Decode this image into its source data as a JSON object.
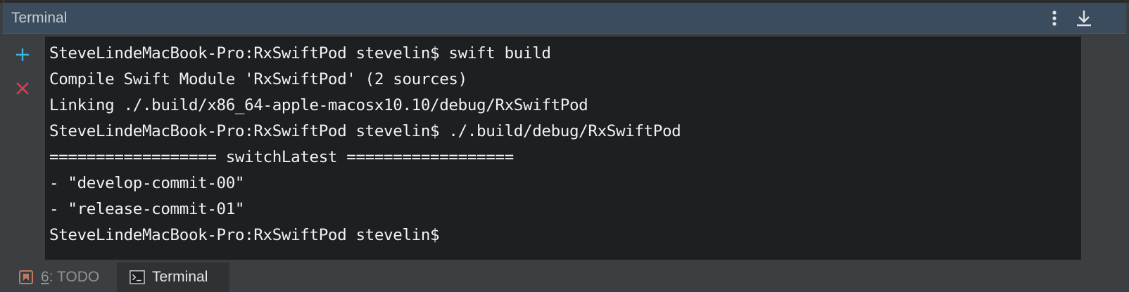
{
  "header": {
    "title": "Terminal",
    "more_icon": "vertical-ellipsis-icon",
    "hide_icon": "download-arrow-icon"
  },
  "toolbar": {
    "add_icon": "plus-icon",
    "close_icon": "close-x-icon"
  },
  "terminal": {
    "lines": [
      "SteveLindeMacBook-Pro:RxSwiftPod stevelin$ swift build",
      "Compile Swift Module 'RxSwiftPod' (2 sources)",
      "Linking ./.build/x86_64-apple-macosx10.10/debug/RxSwiftPod",
      "SteveLindeMacBook-Pro:RxSwiftPod stevelin$ ./.build/debug/RxSwiftPod",
      "================== switchLatest ==================",
      "- \"develop-commit-00\"",
      "- \"release-commit-01\"",
      "SteveLindeMacBook-Pro:RxSwiftPod stevelin$"
    ]
  },
  "bottom_tabs": {
    "todo": {
      "number": "6",
      "label": ": TODO",
      "icon": "todo-list-icon"
    },
    "terminal": {
      "label": "Terminal",
      "icon": "terminal-icon"
    }
  },
  "colors": {
    "header_bg": "#3b4c5e",
    "terminal_bg": "#1d1f21",
    "add_accent": "#3fb6d9",
    "close_accent": "#e0394a",
    "todo_icon": "#c07a63"
  }
}
